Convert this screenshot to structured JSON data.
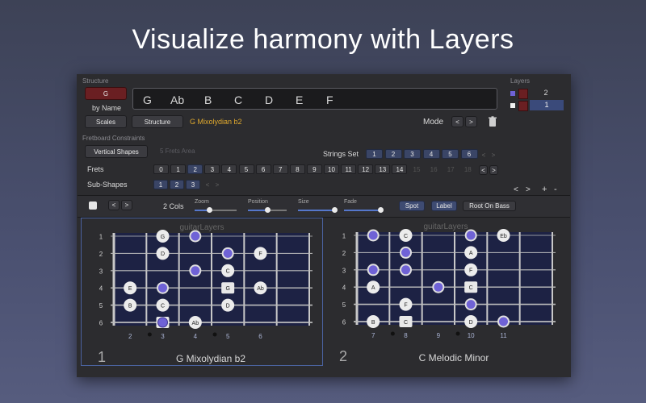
{
  "hero_title": "Visualize harmony with Layers",
  "structure": {
    "section_label": "Structure",
    "root_button": "G",
    "by_name": "by Name",
    "scales_button": "Scales",
    "structure_button": "Structure",
    "structure_name": "G Mixolydian b2",
    "notes": [
      "G",
      "Ab",
      "B",
      "C",
      "D",
      "E",
      "F"
    ],
    "mode_label": "Mode",
    "prev": "<",
    "next": ">"
  },
  "constraints": {
    "section_label": "Fretboard Constraints",
    "shapes_button": "Vertical Shapes",
    "area_placeholder": "5 Frets Area",
    "strings_set_label": "Strings Set",
    "strings": [
      "1",
      "2",
      "3",
      "4",
      "5",
      "6"
    ],
    "frets_label": "Frets",
    "frets": [
      "0",
      "1",
      "2",
      "3",
      "4",
      "5",
      "6",
      "7",
      "8",
      "9",
      "10",
      "11",
      "12",
      "13",
      "14",
      "15",
      "16",
      "17",
      "18"
    ],
    "active_fret": "2",
    "subshapes_label": "Sub-Shapes",
    "subshapes": [
      "1",
      "2",
      "3"
    ]
  },
  "layers": {
    "section_label": "Layers",
    "items": [
      {
        "number": "2",
        "color": "#6f62d6"
      },
      {
        "number": "1",
        "color": "#f0f0f0"
      }
    ],
    "nav_prev": "<",
    "nav_next": ">",
    "add": "+",
    "remove": "-"
  },
  "toolbar": {
    "cols_label": "2 Cols",
    "zoom_label": "Zoom",
    "zoom_value": 0.35,
    "position_label": "Position",
    "position_value": 0.5,
    "size_label": "Size",
    "size_value": 0.95,
    "fade_label": "Fade",
    "fade_value": 0.95,
    "spot_button": "Spot",
    "label_button": "Label",
    "root_on_bass_button": "Root On Bass"
  },
  "views": [
    {
      "title": "guitarLayers",
      "index": "1",
      "name": "G Mixolydian b2",
      "string_labels": [
        "1",
        "2",
        "3",
        "4",
        "5",
        "6"
      ],
      "fret_labels": [
        "2",
        "3",
        "4",
        "5",
        "6"
      ],
      "notes": [
        {
          "s": 1,
          "f": 3,
          "label": "G",
          "kind": "white"
        },
        {
          "s": 1,
          "f": 4,
          "label": "",
          "kind": "blue"
        },
        {
          "s": 2,
          "f": 3,
          "label": "D",
          "kind": "white"
        },
        {
          "s": 2,
          "f": 5,
          "label": "",
          "kind": "blue"
        },
        {
          "s": 2,
          "f": 6,
          "label": "F",
          "kind": "white"
        },
        {
          "s": 3,
          "f": 4,
          "label": "",
          "kind": "blue"
        },
        {
          "s": 3,
          "f": 5,
          "label": "C",
          "kind": "white"
        },
        {
          "s": 4,
          "f": 2,
          "label": "E",
          "kind": "white"
        },
        {
          "s": 4,
          "f": 3,
          "label": "",
          "kind": "blue"
        },
        {
          "s": 4,
          "f": 5,
          "label": "G",
          "kind": "square"
        },
        {
          "s": 4,
          "f": 6,
          "label": "Ab",
          "kind": "white"
        },
        {
          "s": 5,
          "f": 2,
          "label": "B",
          "kind": "white"
        },
        {
          "s": 5,
          "f": 3,
          "label": "C",
          "kind": "white"
        },
        {
          "s": 5,
          "f": 5,
          "label": "D",
          "kind": "white"
        },
        {
          "s": 6,
          "f": 3,
          "label": "",
          "kind": "bluesquare"
        },
        {
          "s": 6,
          "f": 4,
          "label": "Ab",
          "kind": "white"
        }
      ]
    },
    {
      "title": "guitarLayers",
      "index": "2",
      "name": "C Melodic Minor",
      "string_labels": [
        "1",
        "2",
        "3",
        "4",
        "5",
        "6"
      ],
      "fret_labels": [
        "7",
        "8",
        "9",
        "10",
        "11"
      ],
      "notes": [
        {
          "s": 1,
          "f": 7,
          "label": "",
          "kind": "blue"
        },
        {
          "s": 1,
          "f": 8,
          "label": "C",
          "kind": "white"
        },
        {
          "s": 1,
          "f": 10,
          "label": "",
          "kind": "blue"
        },
        {
          "s": 1,
          "f": 11,
          "label": "Eb",
          "kind": "white"
        },
        {
          "s": 2,
          "f": 8,
          "label": "",
          "kind": "blue"
        },
        {
          "s": 2,
          "f": 10,
          "label": "A",
          "kind": "white"
        },
        {
          "s": 3,
          "f": 7,
          "label": "",
          "kind": "blue"
        },
        {
          "s": 3,
          "f": 8,
          "label": "",
          "kind": "blue"
        },
        {
          "s": 3,
          "f": 10,
          "label": "F",
          "kind": "white"
        },
        {
          "s": 4,
          "f": 7,
          "label": "A",
          "kind": "white"
        },
        {
          "s": 4,
          "f": 9,
          "label": "",
          "kind": "blue"
        },
        {
          "s": 4,
          "f": 10,
          "label": "C",
          "kind": "square"
        },
        {
          "s": 5,
          "f": 8,
          "label": "F",
          "kind": "white"
        },
        {
          "s": 5,
          "f": 10,
          "label": "",
          "kind": "blue"
        },
        {
          "s": 6,
          "f": 7,
          "label": "B",
          "kind": "white"
        },
        {
          "s": 6,
          "f": 8,
          "label": "C",
          "kind": "square"
        },
        {
          "s": 6,
          "f": 10,
          "label": "D",
          "kind": "white"
        },
        {
          "s": 6,
          "f": 11,
          "label": "",
          "kind": "blue"
        }
      ]
    }
  ]
}
